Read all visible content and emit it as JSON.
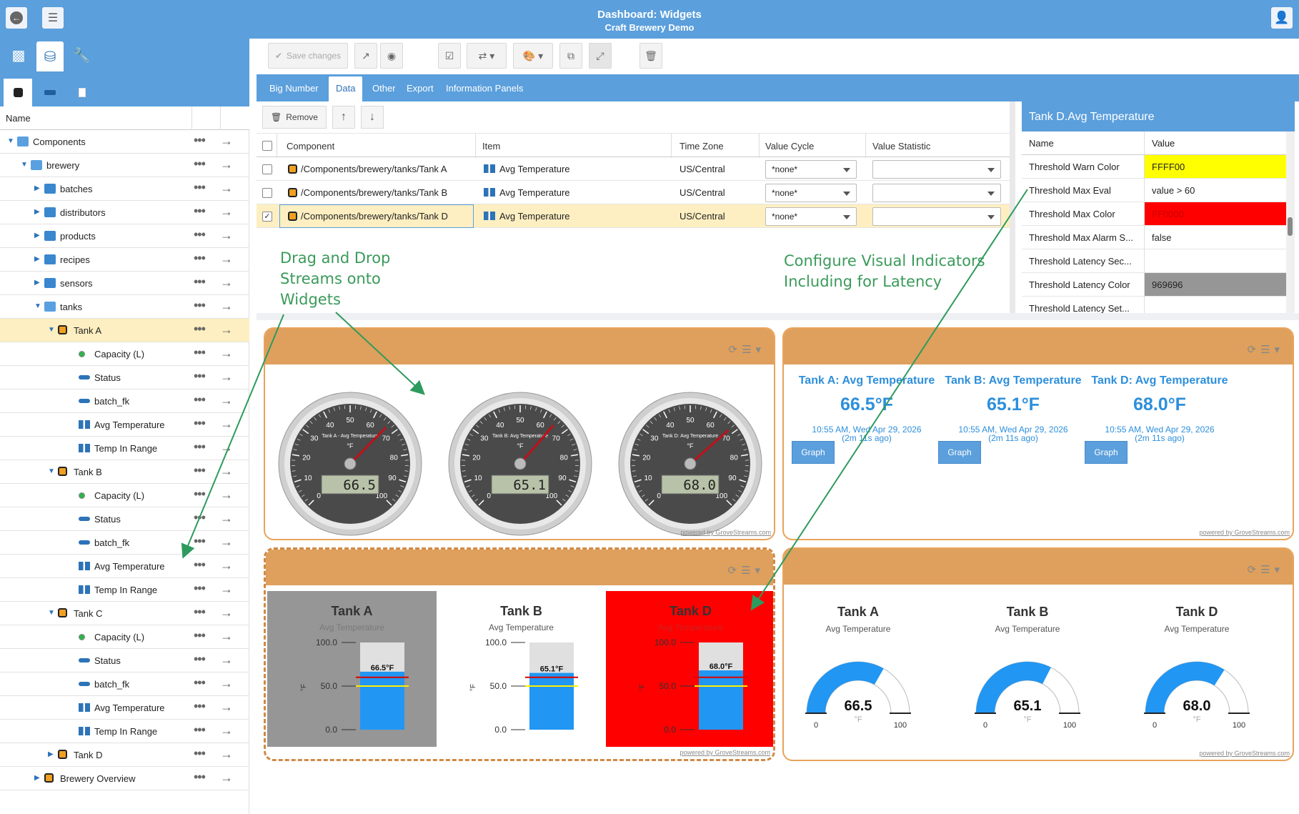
{
  "header": {
    "title": "Dashboard: Widgets",
    "subtitle": "Craft Brewery Demo"
  },
  "tree": {
    "column_name": "Name",
    "rows": [
      {
        "label": "Components",
        "depth": 0,
        "icon": "folder-open",
        "expanded": true
      },
      {
        "label": "brewery",
        "depth": 1,
        "icon": "folder-open",
        "expanded": true
      },
      {
        "label": "batches",
        "depth": 2,
        "icon": "folder",
        "expanded": false
      },
      {
        "label": "distributors",
        "depth": 2,
        "icon": "folder",
        "expanded": false
      },
      {
        "label": "products",
        "depth": 2,
        "icon": "folder",
        "expanded": false
      },
      {
        "label": "recipes",
        "depth": 2,
        "icon": "folder",
        "expanded": false
      },
      {
        "label": "sensors",
        "depth": 2,
        "icon": "folder",
        "expanded": false
      },
      {
        "label": "tanks",
        "depth": 2,
        "icon": "folder-open",
        "expanded": true
      },
      {
        "label": "Tank A",
        "depth": 3,
        "icon": "component",
        "expanded": true,
        "selected": true
      },
      {
        "label": "Capacity (L)",
        "depth": 4,
        "icon": "dot"
      },
      {
        "label": "Status",
        "depth": 4,
        "icon": "pill"
      },
      {
        "label": "batch_fk",
        "depth": 4,
        "icon": "pill"
      },
      {
        "label": "Avg Temperature",
        "depth": 4,
        "icon": "stream"
      },
      {
        "label": "Temp In Range",
        "depth": 4,
        "icon": "stream"
      },
      {
        "label": "Tank B",
        "depth": 3,
        "icon": "component",
        "expanded": true
      },
      {
        "label": "Capacity (L)",
        "depth": 4,
        "icon": "dot"
      },
      {
        "label": "Status",
        "depth": 4,
        "icon": "pill"
      },
      {
        "label": "batch_fk",
        "depth": 4,
        "icon": "pill"
      },
      {
        "label": "Avg Temperature",
        "depth": 4,
        "icon": "stream"
      },
      {
        "label": "Temp In Range",
        "depth": 4,
        "icon": "stream"
      },
      {
        "label": "Tank C",
        "depth": 3,
        "icon": "component",
        "expanded": true
      },
      {
        "label": "Capacity (L)",
        "depth": 4,
        "icon": "dot"
      },
      {
        "label": "Status",
        "depth": 4,
        "icon": "pill"
      },
      {
        "label": "batch_fk",
        "depth": 4,
        "icon": "pill"
      },
      {
        "label": "Avg Temperature",
        "depth": 4,
        "icon": "stream"
      },
      {
        "label": "Temp In Range",
        "depth": 4,
        "icon": "stream"
      },
      {
        "label": "Tank D",
        "depth": 3,
        "icon": "component",
        "expanded": false
      },
      {
        "label": "Brewery Overview",
        "depth": 2,
        "icon": "component",
        "expanded": false
      }
    ]
  },
  "toolbar": {
    "save_label": "Save changes"
  },
  "tabs": [
    "Big Number",
    "Data",
    "Other",
    "Export",
    "Information Panels"
  ],
  "active_tab": "Data",
  "grid": {
    "remove_label": "Remove",
    "columns": [
      "Component",
      "Item",
      "Time Zone",
      "Value Cycle",
      "Value Statistic"
    ],
    "rows": [
      {
        "component": "/Components/brewery/tanks/Tank A",
        "item": "Avg Temperature",
        "tz": "US/Central",
        "cycle": "*none*",
        "stat": "",
        "checked": false
      },
      {
        "component": "/Components/brewery/tanks/Tank B",
        "item": "Avg Temperature",
        "tz": "US/Central",
        "cycle": "*none*",
        "stat": "",
        "checked": false
      },
      {
        "component": "/Components/brewery/tanks/Tank D",
        "item": "Avg Temperature",
        "tz": "US/Central",
        "cycle": "*none*",
        "stat": "",
        "checked": true
      }
    ]
  },
  "annotations": {
    "drag": [
      "Drag and Drop",
      "Streams onto",
      "Widgets"
    ],
    "configure": [
      "Configure Visual Indicators",
      "Including for Latency"
    ]
  },
  "properties": {
    "title": "Tank D.Avg Temperature",
    "col_name": "Name",
    "col_value": "Value",
    "rows": [
      {
        "name": "Threshold Warn Color",
        "value": "FFFF00",
        "bg": "#ffff00",
        "fg": "#222"
      },
      {
        "name": "Threshold Max Eval",
        "value": "value > 60",
        "bg": "#ffffff",
        "fg": "#222"
      },
      {
        "name": "Threshold Max Color",
        "value": "FF0000",
        "bg": "#ff0000",
        "fg": "#cc0000"
      },
      {
        "name": "Threshold Max Alarm S...",
        "value": "false",
        "bg": "#ffffff",
        "fg": "#222"
      },
      {
        "name": "Threshold Latency Sec...",
        "value": "",
        "bg": "#ffffff",
        "fg": "#222"
      },
      {
        "name": "Threshold Latency Color",
        "value": "969696",
        "bg": "#969696",
        "fg": "#222"
      },
      {
        "name": "Threshold Latency Set...",
        "value": "",
        "bg": "#ffffff",
        "fg": "#222"
      }
    ]
  },
  "gauges": [
    {
      "title": "Tank A - Avg Temperature",
      "unit": "°F",
      "value": 66.5,
      "display": "66.5"
    },
    {
      "title": "Tank B: Avg Temperature",
      "unit": "°F",
      "value": 65.1,
      "display": "65.1"
    },
    {
      "title": "Tank D: Avg Temperature",
      "unit": "°F",
      "value": 68.0,
      "display": "68.0"
    }
  ],
  "gauge_scale": {
    "min": 0,
    "max": 100,
    "ticks": [
      "0",
      "10",
      "20",
      "30",
      "40",
      "50",
      "60",
      "70",
      "80",
      "90",
      "100"
    ]
  },
  "big_numbers": [
    {
      "title": "Tank A: Avg Temperature",
      "value": "66.5°F",
      "time": "10:55 AM, Wed Apr 29, 2026",
      "ago": "(2m 11s ago)",
      "button": "Graph"
    },
    {
      "title": "Tank B: Avg Temperature",
      "value": "65.1°F",
      "time": "10:55 AM, Wed Apr 29, 2026",
      "ago": "(2m 11s ago)",
      "button": "Graph"
    },
    {
      "title": "Tank D: Avg Temperature",
      "value": "68.0°F",
      "time": "10:55 AM, Wed Apr 29, 2026",
      "ago": "(2m 11s ago)",
      "button": "Graph"
    }
  ],
  "thermometers": [
    {
      "name": "Tank A",
      "sub": "Avg Temperature",
      "value": 66.5,
      "label": "66.5°F",
      "bg": "#969696"
    },
    {
      "name": "Tank B",
      "sub": "Avg Temperature",
      "value": 65.1,
      "label": "65.1°F",
      "bg": "#ffffff"
    },
    {
      "name": "Tank D",
      "sub": "Avg Temperature",
      "value": 68.0,
      "label": "68.0°F",
      "bg": "#ff0000"
    }
  ],
  "thermo_scale": {
    "ticks": [
      "100.0",
      "50.0",
      "0.0"
    ],
    "unit": "°F",
    "warn": 50,
    "max": 60
  },
  "radials": [
    {
      "name": "Tank A",
      "sub": "Avg Temperature",
      "value": 66.5,
      "display": "66.5",
      "unit": "°F",
      "min": "0",
      "max": "100"
    },
    {
      "name": "Tank B",
      "sub": "Avg Temperature",
      "value": 65.1,
      "display": "65.1",
      "unit": "°F",
      "min": "0",
      "max": "100"
    },
    {
      "name": "Tank D",
      "sub": "Avg Temperature",
      "value": 68.0,
      "display": "68.0",
      "unit": "°F",
      "min": "0",
      "max": "100"
    }
  ],
  "powered_by": "powered by GroveStreams.com",
  "colors": {
    "accent": "#5b9fdc",
    "widget_bar": "#dea05c",
    "value_blue": "#2d8fdc",
    "gauge_fill": "#2196f3"
  }
}
